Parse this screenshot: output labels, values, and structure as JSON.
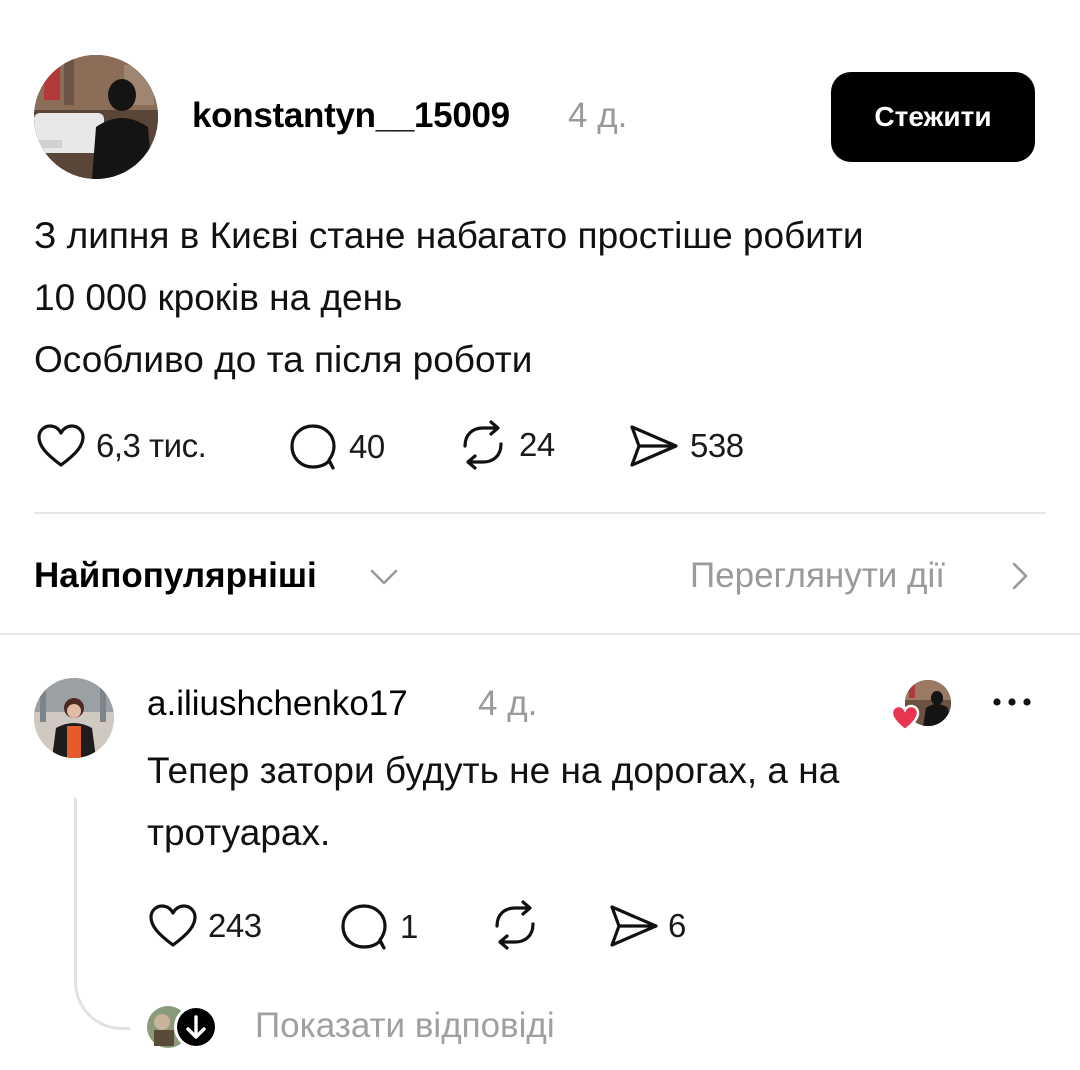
{
  "post": {
    "username": "konstantyn__15009",
    "time": "4 д.",
    "follow_label": "Стежити",
    "text_lines": [
      "З липня в Києві стане набагато простіше робити",
      "10 000 кроків на день",
      "Особливо до та після роботи"
    ],
    "actions": {
      "likes": "6,3 тис.",
      "comments": "40",
      "reposts": "24",
      "shares": "538"
    }
  },
  "sort": {
    "label": "Найпопулярніші",
    "view_activity": "Переглянути дії"
  },
  "comment": {
    "username": "a.iliushchenko17",
    "time": "4 д.",
    "text": "Тепер затори будуть не на дорогах, а на тротуарах.",
    "actions": {
      "likes": "243",
      "comments": "1",
      "reposts": "",
      "shares": "6"
    },
    "show_replies": "Показати відповіді"
  },
  "colors": {
    "follow_bg": "#000000",
    "muted_text": "#9a9a9a",
    "heart_red": "#e8344e"
  },
  "icons": [
    "heart-icon",
    "comment-icon",
    "repost-icon",
    "share-icon",
    "chevron-down-icon",
    "chevron-right-icon",
    "more-icon",
    "arrow-down-icon"
  ]
}
